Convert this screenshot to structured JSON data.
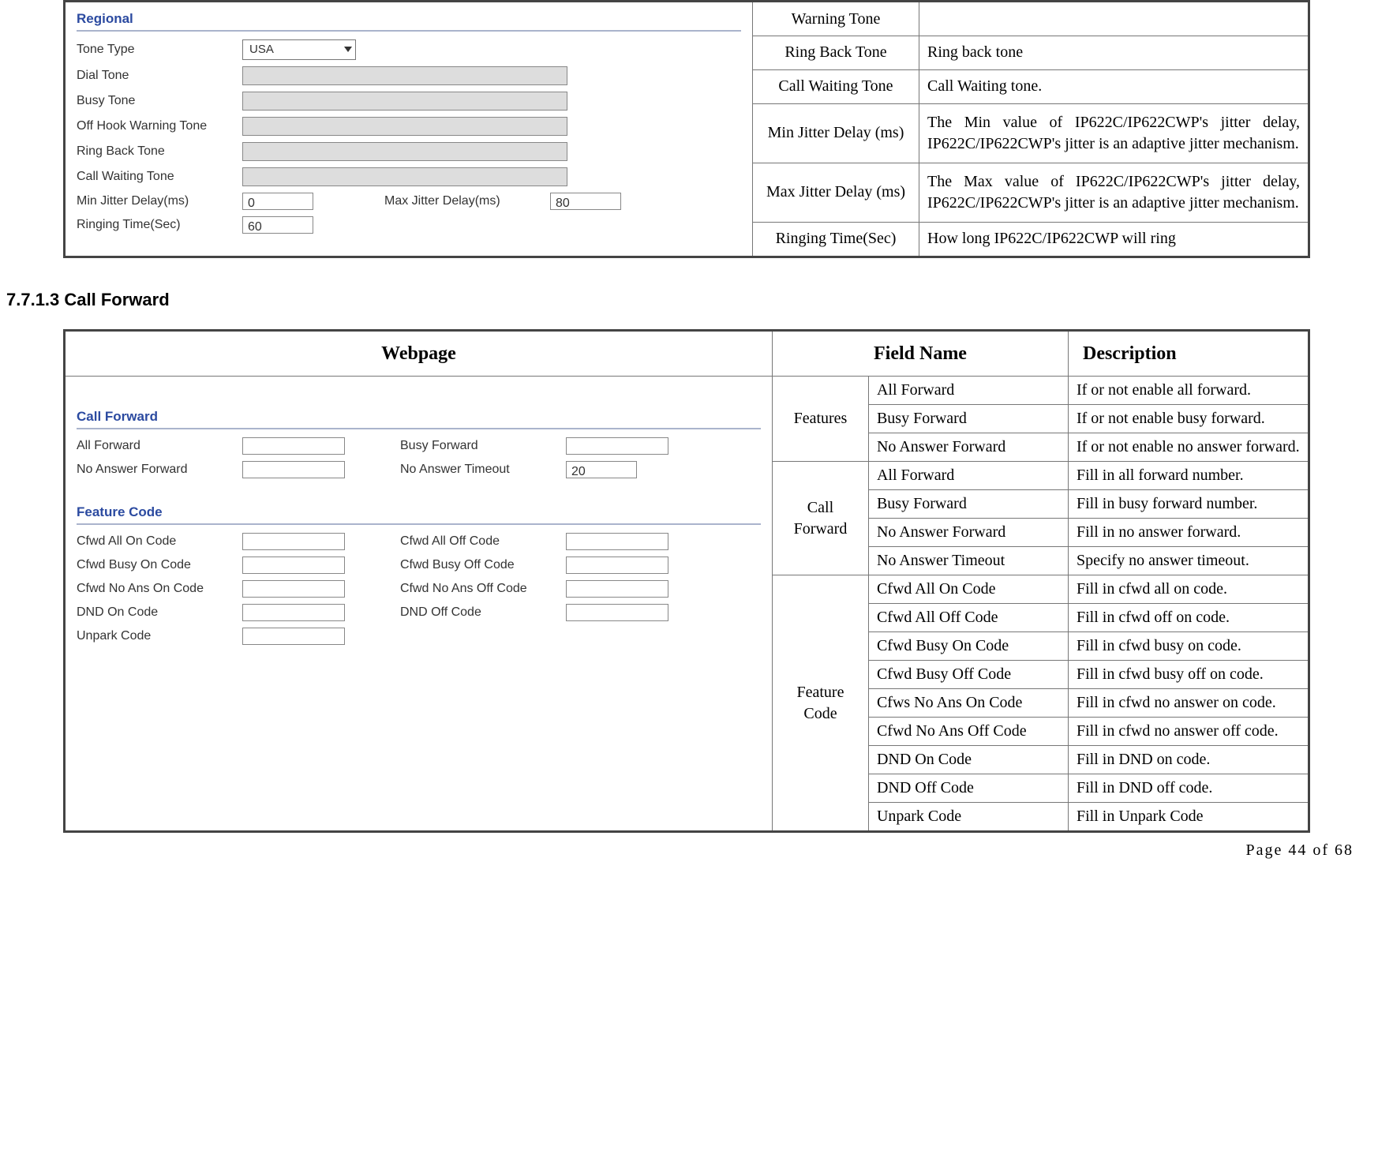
{
  "top_table": {
    "rows": [
      {
        "field": "Warning Tone",
        "desc": ""
      },
      {
        "field": "Ring Back Tone",
        "desc": "Ring back tone"
      },
      {
        "field": "Call Waiting Tone",
        "desc": "Call Waiting tone."
      },
      {
        "field": "Min Jitter Delay (ms)",
        "desc": "The Min value of IP622C/IP622CWP's jitter delay, IP622C/IP622CWP's jitter is an adaptive jitter mechanism."
      },
      {
        "field": "Max Jitter Delay (ms)",
        "desc": "The Max value of IP622C/IP622CWP's jitter delay, IP622C/IP622CWP's jitter is an adaptive jitter mechanism."
      },
      {
        "field": "Ringing Time(Sec)",
        "desc": "How long IP622C/IP622CWP will ring"
      }
    ],
    "panel": {
      "group": "Regional",
      "tone_type_label": "Tone Type",
      "tone_type_value": "USA",
      "rows": [
        "Dial Tone",
        "Busy Tone",
        "Off Hook Warning Tone",
        "Ring Back Tone",
        "Call Waiting Tone"
      ],
      "min_jitter_label": "Min Jitter Delay(ms)",
      "min_jitter_value": "0",
      "max_jitter_label": "Max Jitter Delay(ms)",
      "max_jitter_value": "80",
      "ringing_label": "Ringing Time(Sec)",
      "ringing_value": "60"
    }
  },
  "heading": "7.7.1.3  Call Forward",
  "header": {
    "c1": "Webpage",
    "c2": "Field Name",
    "c3": "Description"
  },
  "groups": {
    "features": "Features",
    "callforward": "Call Forward",
    "featurecode": "Feature Code"
  },
  "rows_features": [
    {
      "name": "All Forward",
      "desc": "If or not enable all forward."
    },
    {
      "name": "Busy Forward",
      "desc": "If or not enable busy forward."
    },
    {
      "name": "No Answer Forward",
      "desc": "If or not enable no answer forward."
    }
  ],
  "rows_cf": [
    {
      "name": "All Forward",
      "desc": "Fill in all forward number."
    },
    {
      "name": "Busy Forward",
      "desc": "Fill in busy forward number."
    },
    {
      "name": "No Answer Forward",
      "desc": "Fill in no answer forward."
    },
    {
      "name": "No Answer Timeout",
      "desc": "Specify no answer timeout."
    }
  ],
  "rows_fc": [
    {
      "name": "Cfwd All On Code",
      "desc": "Fill in cfwd all on code."
    },
    {
      "name": "Cfwd All Off Code",
      "desc": "Fill in cfwd off on code."
    },
    {
      "name": "Cfwd Busy On Code",
      "desc": "Fill in cfwd busy on code."
    },
    {
      "name": "Cfwd Busy Off Code",
      "desc": "Fill in cfwd busy off on code."
    },
    {
      "name": "Cfws No Ans On Code",
      "desc": "Fill in cfwd no answer on code."
    },
    {
      "name": "Cfwd No Ans Off Code",
      "desc": "Fill in cfwd no answer off code."
    },
    {
      "name": "DND On Code",
      "desc": "Fill in DND on code."
    },
    {
      "name": "DND Off Code",
      "desc": "Fill in DND off code."
    },
    {
      "name": "Unpark Code",
      "desc": "Fill in Unpark Code"
    }
  ],
  "panel2": {
    "group1": "Call Forward",
    "r1": [
      {
        "l": "All Forward",
        "l2": "Busy Forward"
      },
      {
        "l": "No Answer Forward",
        "l2": "No Answer Timeout",
        "v2": "20"
      }
    ],
    "group2": "Feature Code",
    "r2": [
      {
        "l": "Cfwd All On Code",
        "l2": "Cfwd All Off Code"
      },
      {
        "l": "Cfwd Busy On Code",
        "l2": "Cfwd Busy Off Code"
      },
      {
        "l": "Cfwd No Ans On Code",
        "l2": "Cfwd No Ans Off Code"
      },
      {
        "l": "DND On Code",
        "l2": "DND Off Code"
      },
      {
        "l": "Unpark Code",
        "l2": ""
      }
    ]
  },
  "footer": "Page 44 of 68"
}
